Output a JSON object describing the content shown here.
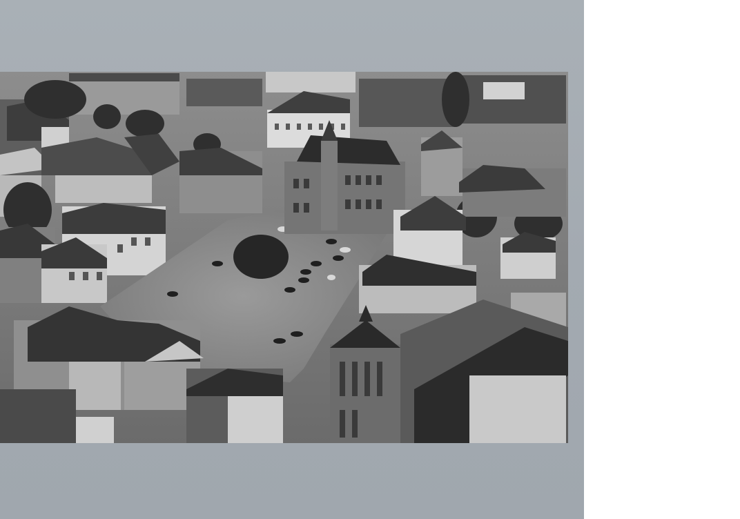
{
  "image": {
    "kind": "photo-postcard",
    "tone": "black-and-white",
    "subject_icons": [
      "town-hall-icon",
      "church-tower-icon",
      "market-square-icon",
      "tree-icon",
      "car-icon"
    ]
  },
  "colors": {
    "scan_background": "#a5acb2",
    "page_background": "#ffffff",
    "square_paving": "#8a8a8a",
    "roof_dark": "#3a3a3a",
    "facade_light": "#cfcfcf"
  }
}
